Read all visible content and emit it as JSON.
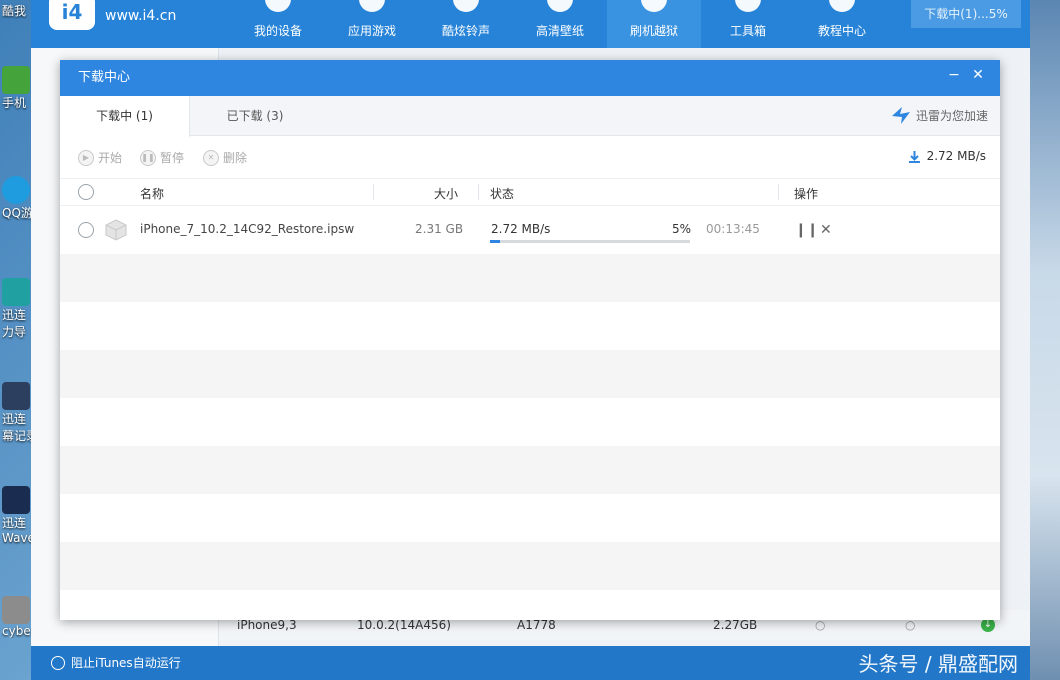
{
  "desktop": {
    "icons": [
      {
        "label": "酷我",
        "color": "#3a72c6"
      },
      {
        "label": "手机",
        "color": "#44a33b"
      },
      {
        "label": "QQ游",
        "color": "#1f9be0"
      },
      {
        "label": "迅连",
        "color": "#20a0a0"
      },
      {
        "label": "力导",
        "color": "#1f7a9e"
      },
      {
        "label": "迅连",
        "color": "#2c3f5f"
      },
      {
        "label": "幕记录",
        "color": "#2c3f5f"
      },
      {
        "label": "迅连",
        "color": "#1a2d50"
      },
      {
        "label": "Wave",
        "color": "#1a2d50"
      },
      {
        "label": "cybe",
        "color": "#8c8c8c"
      }
    ]
  },
  "app": {
    "logo_url": "www.i4.cn",
    "nav": [
      "我的设备",
      "应用游戏",
      "酷炫铃声",
      "高清壁纸",
      "刷机越狱",
      "工具箱",
      "教程中心"
    ],
    "active_nav": "刷机越狱",
    "download_status": "下载中(1)...5%",
    "block_itunes": "阻止iTunes自动运行",
    "watermark": "头条号 / 鼎盛配网",
    "bg_row": {
      "model": "iPhone9,3",
      "version": "10.0.2(14A456)",
      "identifier": "A1778",
      "size": "2.27GB"
    }
  },
  "dialog": {
    "title": "下载中心",
    "tabs": {
      "downloading": "下载中 (1)",
      "downloaded": "已下载 (3)"
    },
    "accelerate": "迅雷为您加速",
    "toolbar": {
      "start": "开始",
      "pause": "暂停",
      "delete": "删除"
    },
    "total_speed": "2.72 MB/s",
    "columns": {
      "name": "名称",
      "size": "大小",
      "status": "状态",
      "action": "操作"
    },
    "rows": [
      {
        "filename": "iPhone_7_10.2_14C92_Restore.ipsw",
        "size": "2.31 GB",
        "speed": "2.72 MB/s",
        "percent": "5%",
        "progress": 0.05,
        "remaining": "00:13:45"
      }
    ],
    "colors": {
      "accent": "#2f86e0",
      "title_bar": "#2f86e0"
    }
  }
}
